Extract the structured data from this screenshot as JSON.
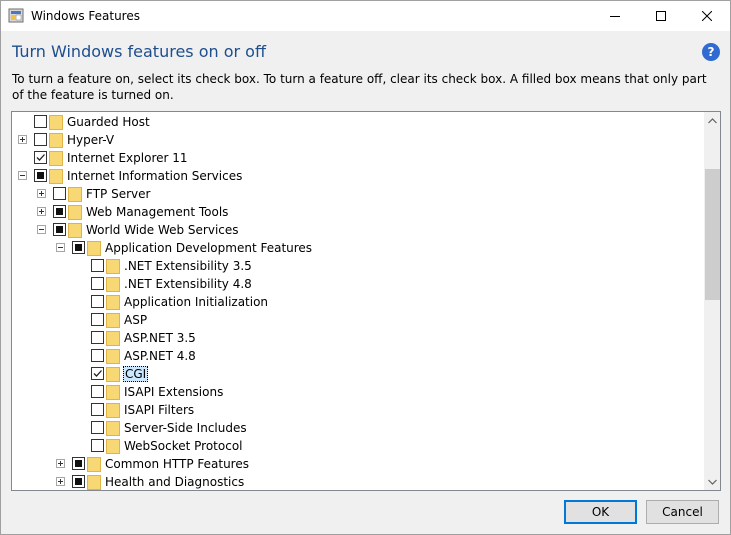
{
  "window": {
    "title": "Windows Features",
    "heading": "Turn Windows features on or off",
    "description": "To turn a feature on, select its check box. To turn a feature off, clear its check box. A filled box means that only part of the feature is turned on.",
    "help_glyph": "?"
  },
  "tree": [
    {
      "label": "Guarded Host",
      "level": 0,
      "expander": "none",
      "state": "unchecked",
      "selected": false
    },
    {
      "label": "Hyper-V",
      "level": 0,
      "expander": "plus",
      "state": "unchecked",
      "selected": false
    },
    {
      "label": "Internet Explorer 11",
      "level": 0,
      "expander": "none",
      "state": "checked",
      "selected": false
    },
    {
      "label": "Internet Information Services",
      "level": 0,
      "expander": "minus",
      "state": "partial",
      "selected": false
    },
    {
      "label": "FTP Server",
      "level": 1,
      "expander": "plus",
      "state": "unchecked",
      "selected": false
    },
    {
      "label": "Web Management Tools",
      "level": 1,
      "expander": "plus",
      "state": "partial",
      "selected": false
    },
    {
      "label": "World Wide Web Services",
      "level": 1,
      "expander": "minus",
      "state": "partial",
      "selected": false
    },
    {
      "label": "Application Development Features",
      "level": 2,
      "expander": "minus",
      "state": "partial",
      "selected": false
    },
    {
      "label": ".NET Extensibility 3.5",
      "level": 3,
      "expander": "none",
      "state": "unchecked",
      "selected": false
    },
    {
      "label": ".NET Extensibility 4.8",
      "level": 3,
      "expander": "none",
      "state": "unchecked",
      "selected": false
    },
    {
      "label": "Application Initialization",
      "level": 3,
      "expander": "none",
      "state": "unchecked",
      "selected": false
    },
    {
      "label": "ASP",
      "level": 3,
      "expander": "none",
      "state": "unchecked",
      "selected": false
    },
    {
      "label": "ASP.NET 3.5",
      "level": 3,
      "expander": "none",
      "state": "unchecked",
      "selected": false
    },
    {
      "label": "ASP.NET 4.8",
      "level": 3,
      "expander": "none",
      "state": "unchecked",
      "selected": false
    },
    {
      "label": "CGI",
      "level": 3,
      "expander": "none",
      "state": "checked",
      "selected": true
    },
    {
      "label": "ISAPI Extensions",
      "level": 3,
      "expander": "none",
      "state": "unchecked",
      "selected": false
    },
    {
      "label": "ISAPI Filters",
      "level": 3,
      "expander": "none",
      "state": "unchecked",
      "selected": false
    },
    {
      "label": "Server-Side Includes",
      "level": 3,
      "expander": "none",
      "state": "unchecked",
      "selected": false
    },
    {
      "label": "WebSocket Protocol",
      "level": 3,
      "expander": "none",
      "state": "unchecked",
      "selected": false
    },
    {
      "label": "Common HTTP Features",
      "level": 2,
      "expander": "plus",
      "state": "partial",
      "selected": false
    },
    {
      "label": "Health and Diagnostics",
      "level": 2,
      "expander": "plus",
      "state": "partial",
      "selected": false
    }
  ],
  "buttons": {
    "ok": "OK",
    "cancel": "Cancel"
  },
  "colors": {
    "heading": "#1e4e8c",
    "accent": "#0078d7",
    "folder": "#f8d775",
    "selection": "#cce8ff"
  },
  "icons": {
    "app": "windows-features-icon",
    "help": "help-icon",
    "folder": "folder-icon",
    "expand": "plus-icon",
    "collapse": "minus-icon"
  }
}
